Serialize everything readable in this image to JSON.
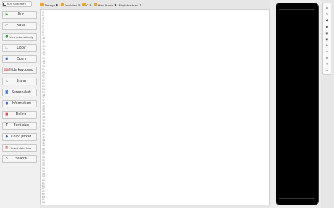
{
  "sidebar": {
    "run_full_screen": "Run full screen",
    "buttons": [
      {
        "label": "Run",
        "icon": "play-icon",
        "color": "#2e9e3a"
      },
      {
        "label": "Save",
        "icon": "save-icon",
        "color": "#333333"
      },
      {
        "label": "Save automatically",
        "icon": "autosave-icon",
        "color": "#2e9e3a"
      },
      {
        "label": "Copy",
        "icon": "copy-icon",
        "color": "#3b6fd1"
      },
      {
        "label": "Open",
        "icon": "open-icon",
        "color": "#3b6fd1"
      },
      {
        "label": "Hide keyboard",
        "icon": "keyboard-icon",
        "color": "#d9534f"
      },
      {
        "label": "Share",
        "icon": "share-icon",
        "color": "#2e9e3a"
      },
      {
        "label": "Screenshot",
        "icon": "camera-icon",
        "color": "#3b6fd1"
      },
      {
        "label": "Information",
        "icon": "info-icon",
        "color": "#3b6fd1"
      },
      {
        "label": "Delete",
        "icon": "delete-icon",
        "color": "#d9534f"
      },
      {
        "label": "Font size",
        "icon": "font-size-icon",
        "color": "#333333"
      },
      {
        "label": "Color picker",
        "icon": "color-picker-icon",
        "color": "#3b6fd1"
      },
      {
        "label": "Insert date time",
        "icon": "calendar-icon",
        "color": "#d9534f"
      },
      {
        "label": "Search",
        "icon": "search-icon",
        "color": "#333333"
      }
    ]
  },
  "breadcrumb": {
    "items": [
      "Storage",
      "Emulated",
      "0",
      "Html Studio",
      "File/index.html"
    ]
  },
  "editor": {
    "line_numbers": [
      "1",
      "2",
      "3",
      "4",
      "5",
      "6",
      "7",
      "8",
      "9",
      "10",
      "11",
      "12",
      "13",
      "14",
      "15",
      "16",
      "17",
      "18",
      "19",
      "20",
      "21",
      "22",
      "23",
      "24",
      "25",
      "26",
      "27",
      "28",
      "29",
      "30",
      "31",
      "32",
      "33",
      "34",
      "35",
      "36",
      "37",
      "38",
      "39",
      "40",
      "41",
      "42",
      "43",
      "44",
      "45",
      "46",
      "47",
      "48",
      "49",
      "50",
      "51",
      "52",
      "53",
      "54",
      "55",
      "56",
      "57",
      "58",
      "59",
      "60",
      "61",
      "62",
      "63",
      "64",
      "65",
      "66",
      "67",
      "68"
    ]
  },
  "right_tools": [
    "power-icon",
    "refresh-icon",
    "volume-up-icon",
    "eraser-icon",
    "screenshot-icon",
    "location-icon",
    "zoom-in-icon",
    "zoom-out-icon",
    "rotate-icon",
    "close-icon",
    "back-icon"
  ]
}
